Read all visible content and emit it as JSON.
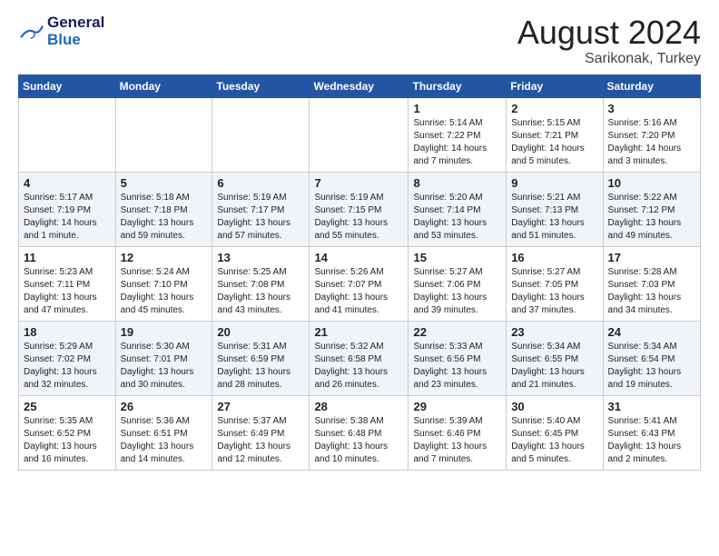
{
  "logo": {
    "line1": "General",
    "line2": "Blue"
  },
  "header": {
    "month": "August 2024",
    "location": "Sarikonak, Turkey"
  },
  "weekdays": [
    "Sunday",
    "Monday",
    "Tuesday",
    "Wednesday",
    "Thursday",
    "Friday",
    "Saturday"
  ],
  "weeks": [
    [
      {
        "day": "",
        "info": ""
      },
      {
        "day": "",
        "info": ""
      },
      {
        "day": "",
        "info": ""
      },
      {
        "day": "",
        "info": ""
      },
      {
        "day": "1",
        "info": "Sunrise: 5:14 AM\nSunset: 7:22 PM\nDaylight: 14 hours\nand 7 minutes."
      },
      {
        "day": "2",
        "info": "Sunrise: 5:15 AM\nSunset: 7:21 PM\nDaylight: 14 hours\nand 5 minutes."
      },
      {
        "day": "3",
        "info": "Sunrise: 5:16 AM\nSunset: 7:20 PM\nDaylight: 14 hours\nand 3 minutes."
      }
    ],
    [
      {
        "day": "4",
        "info": "Sunrise: 5:17 AM\nSunset: 7:19 PM\nDaylight: 14 hours\nand 1 minute."
      },
      {
        "day": "5",
        "info": "Sunrise: 5:18 AM\nSunset: 7:18 PM\nDaylight: 13 hours\nand 59 minutes."
      },
      {
        "day": "6",
        "info": "Sunrise: 5:19 AM\nSunset: 7:17 PM\nDaylight: 13 hours\nand 57 minutes."
      },
      {
        "day": "7",
        "info": "Sunrise: 5:19 AM\nSunset: 7:15 PM\nDaylight: 13 hours\nand 55 minutes."
      },
      {
        "day": "8",
        "info": "Sunrise: 5:20 AM\nSunset: 7:14 PM\nDaylight: 13 hours\nand 53 minutes."
      },
      {
        "day": "9",
        "info": "Sunrise: 5:21 AM\nSunset: 7:13 PM\nDaylight: 13 hours\nand 51 minutes."
      },
      {
        "day": "10",
        "info": "Sunrise: 5:22 AM\nSunset: 7:12 PM\nDaylight: 13 hours\nand 49 minutes."
      }
    ],
    [
      {
        "day": "11",
        "info": "Sunrise: 5:23 AM\nSunset: 7:11 PM\nDaylight: 13 hours\nand 47 minutes."
      },
      {
        "day": "12",
        "info": "Sunrise: 5:24 AM\nSunset: 7:10 PM\nDaylight: 13 hours\nand 45 minutes."
      },
      {
        "day": "13",
        "info": "Sunrise: 5:25 AM\nSunset: 7:08 PM\nDaylight: 13 hours\nand 43 minutes."
      },
      {
        "day": "14",
        "info": "Sunrise: 5:26 AM\nSunset: 7:07 PM\nDaylight: 13 hours\nand 41 minutes."
      },
      {
        "day": "15",
        "info": "Sunrise: 5:27 AM\nSunset: 7:06 PM\nDaylight: 13 hours\nand 39 minutes."
      },
      {
        "day": "16",
        "info": "Sunrise: 5:27 AM\nSunset: 7:05 PM\nDaylight: 13 hours\nand 37 minutes."
      },
      {
        "day": "17",
        "info": "Sunrise: 5:28 AM\nSunset: 7:03 PM\nDaylight: 13 hours\nand 34 minutes."
      }
    ],
    [
      {
        "day": "18",
        "info": "Sunrise: 5:29 AM\nSunset: 7:02 PM\nDaylight: 13 hours\nand 32 minutes."
      },
      {
        "day": "19",
        "info": "Sunrise: 5:30 AM\nSunset: 7:01 PM\nDaylight: 13 hours\nand 30 minutes."
      },
      {
        "day": "20",
        "info": "Sunrise: 5:31 AM\nSunset: 6:59 PM\nDaylight: 13 hours\nand 28 minutes."
      },
      {
        "day": "21",
        "info": "Sunrise: 5:32 AM\nSunset: 6:58 PM\nDaylight: 13 hours\nand 26 minutes."
      },
      {
        "day": "22",
        "info": "Sunrise: 5:33 AM\nSunset: 6:56 PM\nDaylight: 13 hours\nand 23 minutes."
      },
      {
        "day": "23",
        "info": "Sunrise: 5:34 AM\nSunset: 6:55 PM\nDaylight: 13 hours\nand 21 minutes."
      },
      {
        "day": "24",
        "info": "Sunrise: 5:34 AM\nSunset: 6:54 PM\nDaylight: 13 hours\nand 19 minutes."
      }
    ],
    [
      {
        "day": "25",
        "info": "Sunrise: 5:35 AM\nSunset: 6:52 PM\nDaylight: 13 hours\nand 16 minutes."
      },
      {
        "day": "26",
        "info": "Sunrise: 5:36 AM\nSunset: 6:51 PM\nDaylight: 13 hours\nand 14 minutes."
      },
      {
        "day": "27",
        "info": "Sunrise: 5:37 AM\nSunset: 6:49 PM\nDaylight: 13 hours\nand 12 minutes."
      },
      {
        "day": "28",
        "info": "Sunrise: 5:38 AM\nSunset: 6:48 PM\nDaylight: 13 hours\nand 10 minutes."
      },
      {
        "day": "29",
        "info": "Sunrise: 5:39 AM\nSunset: 6:46 PM\nDaylight: 13 hours\nand 7 minutes."
      },
      {
        "day": "30",
        "info": "Sunrise: 5:40 AM\nSunset: 6:45 PM\nDaylight: 13 hours\nand 5 minutes."
      },
      {
        "day": "31",
        "info": "Sunrise: 5:41 AM\nSunset: 6:43 PM\nDaylight: 13 hours\nand 2 minutes."
      }
    ]
  ]
}
